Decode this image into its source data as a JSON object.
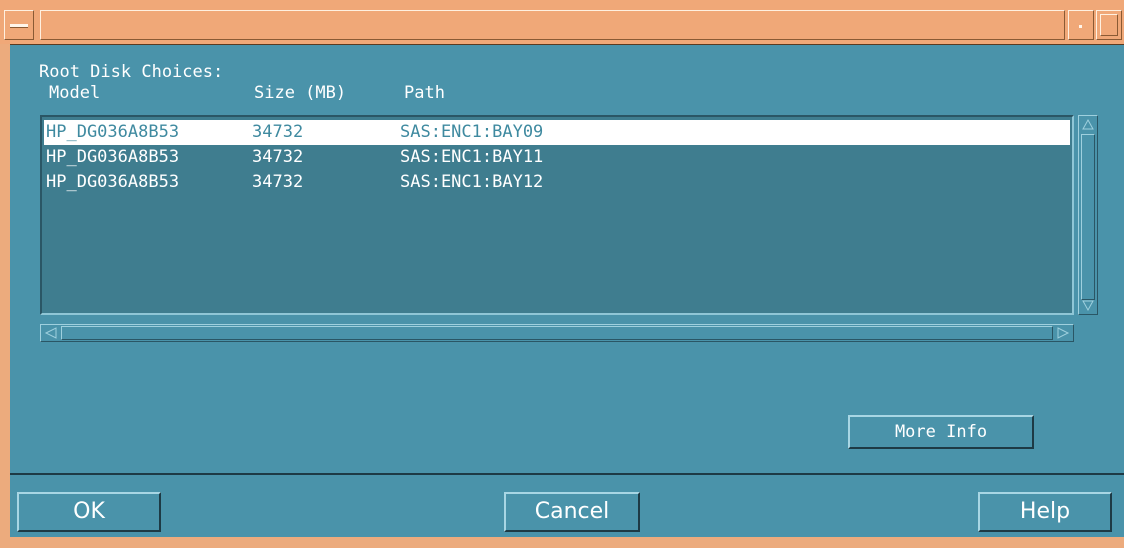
{
  "window": {
    "title": "",
    "frame_color": "#ecab7d",
    "client_color": "#4a93aa"
  },
  "labels": {
    "section_title": "Root Disk Choices:",
    "col_model": "Model",
    "col_size": "Size (MB)",
    "col_path": "Path"
  },
  "disks": [
    {
      "model": "HP_DG036A8B53",
      "size": "34732",
      "path": "SAS:ENC1:BAY09",
      "selected": true
    },
    {
      "model": "HP_DG036A8B53",
      "size": "34732",
      "path": "SAS:ENC1:BAY11",
      "selected": false
    },
    {
      "model": "HP_DG036A8B53",
      "size": "34732",
      "path": "SAS:ENC1:BAY12",
      "selected": false
    }
  ],
  "buttons": {
    "more_info": "More Info",
    "ok": "OK",
    "cancel": "Cancel",
    "help": "Help"
  },
  "icons": {
    "window_menu": "window-menu-icon",
    "minimize": "minimize-icon",
    "maximize": "maximize-icon",
    "scroll_up": "arrow-up-icon",
    "scroll_down": "arrow-down-icon",
    "scroll_left": "arrow-left-icon",
    "scroll_right": "arrow-right-icon"
  }
}
